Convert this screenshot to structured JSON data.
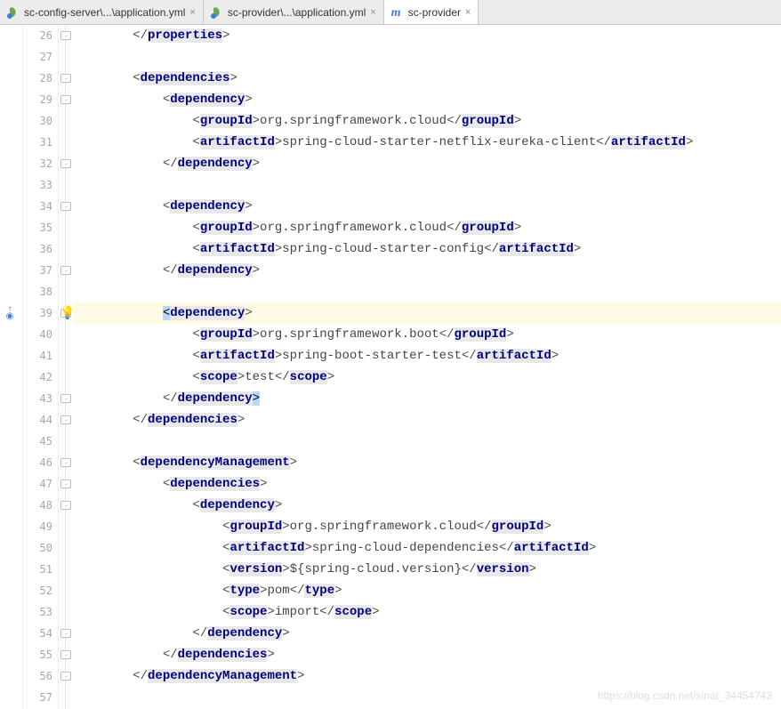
{
  "tabs": [
    {
      "label": "sc-config-server\\...\\application.yml",
      "type": "leaf",
      "active": false
    },
    {
      "label": "sc-provider\\...\\application.yml",
      "type": "leaf",
      "active": false
    },
    {
      "label": "sc-provider",
      "type": "m",
      "active": true
    }
  ],
  "lineStart": 26,
  "lineEnd": 57,
  "highlightLine": 39,
  "code": [
    {
      "n": 26,
      "indent": 2,
      "tokens": [
        {
          "t": "angle",
          "v": "</"
        },
        {
          "t": "tag",
          "v": "properties"
        },
        {
          "t": "angle",
          "v": ">"
        }
      ]
    },
    {
      "n": 27,
      "indent": 0,
      "tokens": []
    },
    {
      "n": 28,
      "indent": 2,
      "tokens": [
        {
          "t": "angle",
          "v": "<"
        },
        {
          "t": "tag",
          "v": "dependencies"
        },
        {
          "t": "angle",
          "v": ">"
        }
      ]
    },
    {
      "n": 29,
      "indent": 3,
      "tokens": [
        {
          "t": "angle",
          "v": "<"
        },
        {
          "t": "tag",
          "v": "dependency"
        },
        {
          "t": "angle",
          "v": ">"
        }
      ]
    },
    {
      "n": 30,
      "indent": 4,
      "tokens": [
        {
          "t": "angle",
          "v": "<"
        },
        {
          "t": "tag",
          "v": "groupId"
        },
        {
          "t": "angle",
          "v": ">"
        },
        {
          "t": "text",
          "v": "org.springframework.cloud"
        },
        {
          "t": "angle",
          "v": "</"
        },
        {
          "t": "tag",
          "v": "groupId"
        },
        {
          "t": "angle",
          "v": ">"
        }
      ]
    },
    {
      "n": 31,
      "indent": 4,
      "tokens": [
        {
          "t": "angle",
          "v": "<"
        },
        {
          "t": "tag",
          "v": "artifactId"
        },
        {
          "t": "angle",
          "v": ">"
        },
        {
          "t": "text",
          "v": "spring-cloud-starter-netflix-eureka-client"
        },
        {
          "t": "angle",
          "v": "</"
        },
        {
          "t": "tag",
          "v": "artifactId"
        },
        {
          "t": "angle",
          "v": ">"
        }
      ]
    },
    {
      "n": 32,
      "indent": 3,
      "tokens": [
        {
          "t": "angle",
          "v": "</"
        },
        {
          "t": "tag",
          "v": "dependency"
        },
        {
          "t": "angle",
          "v": ">"
        }
      ]
    },
    {
      "n": 33,
      "indent": 0,
      "tokens": []
    },
    {
      "n": 34,
      "indent": 3,
      "tokens": [
        {
          "t": "angle",
          "v": "<"
        },
        {
          "t": "tag",
          "v": "dependency"
        },
        {
          "t": "angle",
          "v": ">"
        }
      ]
    },
    {
      "n": 35,
      "indent": 4,
      "tokens": [
        {
          "t": "angle",
          "v": "<"
        },
        {
          "t": "tag",
          "v": "groupId"
        },
        {
          "t": "angle",
          "v": ">"
        },
        {
          "t": "text",
          "v": "org.springframework.cloud"
        },
        {
          "t": "angle",
          "v": "</"
        },
        {
          "t": "tag",
          "v": "groupId"
        },
        {
          "t": "angle",
          "v": ">"
        }
      ]
    },
    {
      "n": 36,
      "indent": 4,
      "tokens": [
        {
          "t": "angle",
          "v": "<"
        },
        {
          "t": "tag",
          "v": "artifactId"
        },
        {
          "t": "angle",
          "v": ">"
        },
        {
          "t": "text",
          "v": "spring-cloud-starter-config"
        },
        {
          "t": "angle",
          "v": "</"
        },
        {
          "t": "tag",
          "v": "artifactId"
        },
        {
          "t": "angle",
          "v": ">"
        }
      ]
    },
    {
      "n": 37,
      "indent": 3,
      "tokens": [
        {
          "t": "angle",
          "v": "</"
        },
        {
          "t": "tag",
          "v": "dependency"
        },
        {
          "t": "angle",
          "v": ">"
        }
      ]
    },
    {
      "n": 38,
      "indent": 0,
      "tokens": []
    },
    {
      "n": 39,
      "indent": 3,
      "hl": true,
      "tokens": [
        {
          "t": "sel",
          "v": "<"
        },
        {
          "t": "tag",
          "v": "dependency"
        },
        {
          "t": "angle",
          "v": ">"
        }
      ]
    },
    {
      "n": 40,
      "indent": 4,
      "tokens": [
        {
          "t": "angle",
          "v": "<"
        },
        {
          "t": "tag",
          "v": "groupId"
        },
        {
          "t": "angle",
          "v": ">"
        },
        {
          "t": "text",
          "v": "org.springframework.boot"
        },
        {
          "t": "angle",
          "v": "</"
        },
        {
          "t": "tag",
          "v": "groupId"
        },
        {
          "t": "angle",
          "v": ">"
        }
      ]
    },
    {
      "n": 41,
      "indent": 4,
      "tokens": [
        {
          "t": "angle",
          "v": "<"
        },
        {
          "t": "tag",
          "v": "artifactId"
        },
        {
          "t": "angle",
          "v": ">"
        },
        {
          "t": "text",
          "v": "spring-boot-starter-test"
        },
        {
          "t": "angle",
          "v": "</"
        },
        {
          "t": "tag",
          "v": "artifactId"
        },
        {
          "t": "angle",
          "v": ">"
        }
      ]
    },
    {
      "n": 42,
      "indent": 4,
      "tokens": [
        {
          "t": "angle",
          "v": "<"
        },
        {
          "t": "tag",
          "v": "scope"
        },
        {
          "t": "angle",
          "v": ">"
        },
        {
          "t": "text",
          "v": "test"
        },
        {
          "t": "angle",
          "v": "</"
        },
        {
          "t": "tag",
          "v": "scope"
        },
        {
          "t": "angle",
          "v": ">"
        }
      ]
    },
    {
      "n": 43,
      "indent": 3,
      "tokens": [
        {
          "t": "angle",
          "v": "</"
        },
        {
          "t": "tag",
          "v": "dependency"
        },
        {
          "t": "sel",
          "v": ">"
        }
      ]
    },
    {
      "n": 44,
      "indent": 2,
      "tokens": [
        {
          "t": "angle",
          "v": "</"
        },
        {
          "t": "tag",
          "v": "dependencies"
        },
        {
          "t": "angle",
          "v": ">"
        }
      ]
    },
    {
      "n": 45,
      "indent": 0,
      "tokens": []
    },
    {
      "n": 46,
      "indent": 2,
      "tokens": [
        {
          "t": "angle",
          "v": "<"
        },
        {
          "t": "tag",
          "v": "dependencyManagement"
        },
        {
          "t": "angle",
          "v": ">"
        }
      ]
    },
    {
      "n": 47,
      "indent": 3,
      "tokens": [
        {
          "t": "angle",
          "v": "<"
        },
        {
          "t": "tag",
          "v": "dependencies"
        },
        {
          "t": "angle",
          "v": ">"
        }
      ]
    },
    {
      "n": 48,
      "indent": 4,
      "tokens": [
        {
          "t": "angle",
          "v": "<"
        },
        {
          "t": "tag",
          "v": "dependency"
        },
        {
          "t": "angle",
          "v": ">"
        }
      ]
    },
    {
      "n": 49,
      "indent": 5,
      "tokens": [
        {
          "t": "angle",
          "v": "<"
        },
        {
          "t": "tag",
          "v": "groupId"
        },
        {
          "t": "angle",
          "v": ">"
        },
        {
          "t": "text",
          "v": "org.springframework.cloud"
        },
        {
          "t": "angle",
          "v": "</"
        },
        {
          "t": "tag",
          "v": "groupId"
        },
        {
          "t": "angle",
          "v": ">"
        }
      ]
    },
    {
      "n": 50,
      "indent": 5,
      "tokens": [
        {
          "t": "angle",
          "v": "<"
        },
        {
          "t": "tag",
          "v": "artifactId"
        },
        {
          "t": "angle",
          "v": ">"
        },
        {
          "t": "text",
          "v": "spring-cloud-dependencies"
        },
        {
          "t": "angle",
          "v": "</"
        },
        {
          "t": "tag",
          "v": "artifactId"
        },
        {
          "t": "angle",
          "v": ">"
        }
      ]
    },
    {
      "n": 51,
      "indent": 5,
      "tokens": [
        {
          "t": "angle",
          "v": "<"
        },
        {
          "t": "tag",
          "v": "version"
        },
        {
          "t": "angle",
          "v": ">"
        },
        {
          "t": "text",
          "v": "${spring-cloud.version}"
        },
        {
          "t": "angle",
          "v": "</"
        },
        {
          "t": "tag",
          "v": "version"
        },
        {
          "t": "angle",
          "v": ">"
        }
      ]
    },
    {
      "n": 52,
      "indent": 5,
      "tokens": [
        {
          "t": "angle",
          "v": "<"
        },
        {
          "t": "tag",
          "v": "type"
        },
        {
          "t": "angle",
          "v": ">"
        },
        {
          "t": "text",
          "v": "pom"
        },
        {
          "t": "angle",
          "v": "</"
        },
        {
          "t": "tag",
          "v": "type"
        },
        {
          "t": "angle",
          "v": ">"
        }
      ]
    },
    {
      "n": 53,
      "indent": 5,
      "tokens": [
        {
          "t": "angle",
          "v": "<"
        },
        {
          "t": "tag",
          "v": "scope"
        },
        {
          "t": "angle",
          "v": ">"
        },
        {
          "t": "text",
          "v": "import"
        },
        {
          "t": "angle",
          "v": "</"
        },
        {
          "t": "tag",
          "v": "scope"
        },
        {
          "t": "angle",
          "v": ">"
        }
      ]
    },
    {
      "n": 54,
      "indent": 4,
      "tokens": [
        {
          "t": "angle",
          "v": "</"
        },
        {
          "t": "tag",
          "v": "dependency"
        },
        {
          "t": "angle",
          "v": ">"
        }
      ]
    },
    {
      "n": 55,
      "indent": 3,
      "tokens": [
        {
          "t": "angle",
          "v": "</"
        },
        {
          "t": "tag",
          "v": "dependencies"
        },
        {
          "t": "angle",
          "v": ">"
        }
      ]
    },
    {
      "n": 56,
      "indent": 2,
      "tokens": [
        {
          "t": "angle",
          "v": "</"
        },
        {
          "t": "tag",
          "v": "dependencyManagement"
        },
        {
          "t": "angle",
          "v": ">"
        }
      ]
    },
    {
      "n": 57,
      "indent": 0,
      "tokens": []
    }
  ],
  "foldMarks": [
    26,
    28,
    29,
    32,
    34,
    37,
    39,
    43,
    44,
    46,
    47,
    48,
    54,
    55,
    56
  ],
  "watermark": "https://blog.csdn.net/sinat_34454743"
}
